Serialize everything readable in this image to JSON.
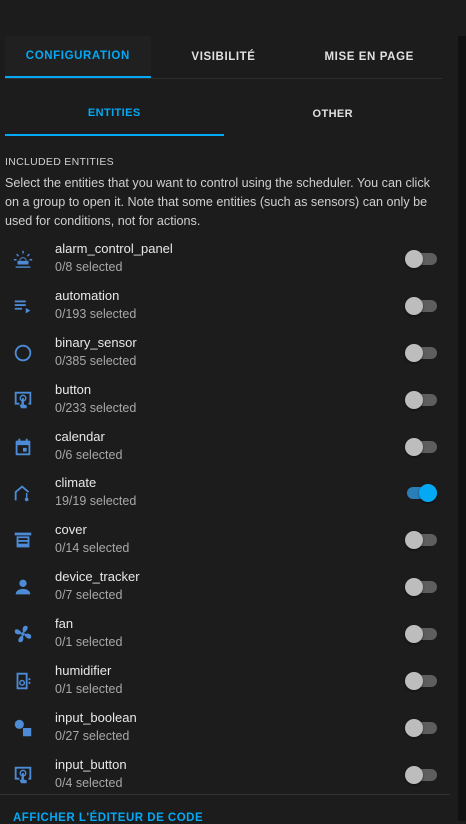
{
  "tabs": [
    "CONFIGURATION",
    "VISIBILITÉ",
    "MISE EN PAGE"
  ],
  "subtabs": [
    "ENTITIES",
    "OTHER"
  ],
  "section": {
    "title": "INCLUDED ENTITIES",
    "description": "Select the entities that you want to control using the scheduler. You can click on a group to open it. Note that some entities (such as sensors) can only be used for conditions, not for actions."
  },
  "entities": [
    {
      "name": "alarm_control_panel",
      "count": "0/8 selected",
      "icon": "alarm-light-icon",
      "on": false
    },
    {
      "name": "automation",
      "count": "0/193 selected",
      "icon": "playlist-play-icon",
      "on": false
    },
    {
      "name": "binary_sensor",
      "count": "0/385 selected",
      "icon": "circle-outline-icon",
      "on": false
    },
    {
      "name": "button",
      "count": "0/233 selected",
      "icon": "gesture-tap-button-icon",
      "on": false
    },
    {
      "name": "calendar",
      "count": "0/6 selected",
      "icon": "calendar-icon",
      "on": false
    },
    {
      "name": "climate",
      "count": "19/19 selected",
      "icon": "home-thermometer-icon",
      "on": true
    },
    {
      "name": "cover",
      "count": "0/14 selected",
      "icon": "window-shutter-icon",
      "on": false
    },
    {
      "name": "device_tracker",
      "count": "0/7 selected",
      "icon": "account-icon",
      "on": false
    },
    {
      "name": "fan",
      "count": "0/1 selected",
      "icon": "fan-icon",
      "on": false
    },
    {
      "name": "humidifier",
      "count": "0/1 selected",
      "icon": "air-humidifier-icon",
      "on": false
    },
    {
      "name": "input_boolean",
      "count": "0/27 selected",
      "icon": "toggle-shapes-icon",
      "on": false
    },
    {
      "name": "input_button",
      "count": "0/4 selected",
      "icon": "gesture-tap-button-icon",
      "on": false
    }
  ],
  "footer": {
    "code_editor_label": "AFFICHER L'ÉDITEUR DE CODE"
  },
  "colors": {
    "accent": "#03a9f4",
    "icon": "#4d8bd6",
    "background": "#1c1c1c"
  }
}
